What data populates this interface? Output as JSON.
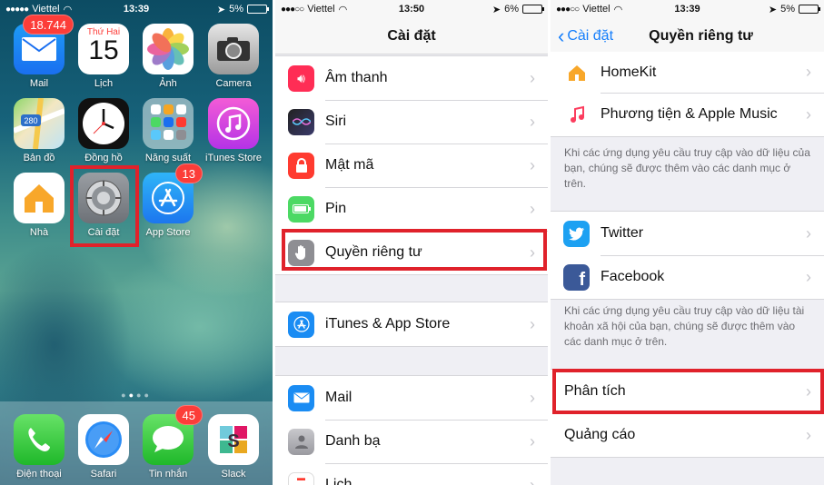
{
  "home": {
    "status": {
      "carrier": "Viettel",
      "time": "13:39",
      "battery": "5%"
    },
    "apps": [
      {
        "label": "Mail",
        "badge": "18.744"
      },
      {
        "label": "Lịch",
        "day": "Thứ Hai",
        "date": "15"
      },
      {
        "label": "Ảnh"
      },
      {
        "label": "Camera"
      },
      {
        "label": "Bản đồ",
        "sign": "280"
      },
      {
        "label": "Đồng hồ"
      },
      {
        "label": "Năng suất"
      },
      {
        "label": "iTunes Store"
      },
      {
        "label": "Nhà"
      },
      {
        "label": "Cài đặt"
      },
      {
        "label": "App Store",
        "badge": "13"
      }
    ],
    "dock": [
      {
        "label": "Điện thoại"
      },
      {
        "label": "Safari"
      },
      {
        "label": "Tin nhắn",
        "badge": "45"
      },
      {
        "label": "Slack"
      }
    ]
  },
  "settings": {
    "status": {
      "carrier": "Viettel",
      "time": "13:50",
      "battery": "6%"
    },
    "title": "Cài đặt",
    "group1": [
      "Âm thanh",
      "Siri",
      "Mật mã",
      "Pin",
      "Quyền riêng tư"
    ],
    "group2": [
      "iTunes & App Store"
    ],
    "group3": [
      "Mail",
      "Danh bạ",
      "Lịch"
    ]
  },
  "privacy": {
    "status": {
      "carrier": "Viettel",
      "time": "13:39",
      "battery": "5%"
    },
    "back": "Cài đặt",
    "title": "Quyền riêng tư",
    "group1": [
      "HomeKit",
      "Phương tiện & Apple Music"
    ],
    "note1": "Khi các ứng dụng yêu cầu truy cập vào dữ liệu của bạn, chúng sẽ được thêm vào các danh mục ở trên.",
    "group2": [
      "Twitter",
      "Facebook"
    ],
    "note2": "Khi các ứng dụng yêu cầu truy cập vào dữ liệu tài khoản xã hội của bạn, chúng sẽ được thêm vào các danh mục ở trên.",
    "group3": [
      "Phân tích",
      "Quảng cáo"
    ]
  },
  "colors": {
    "highlight": "#e0222b",
    "link": "#157efb",
    "badge": "#fc3d39"
  }
}
